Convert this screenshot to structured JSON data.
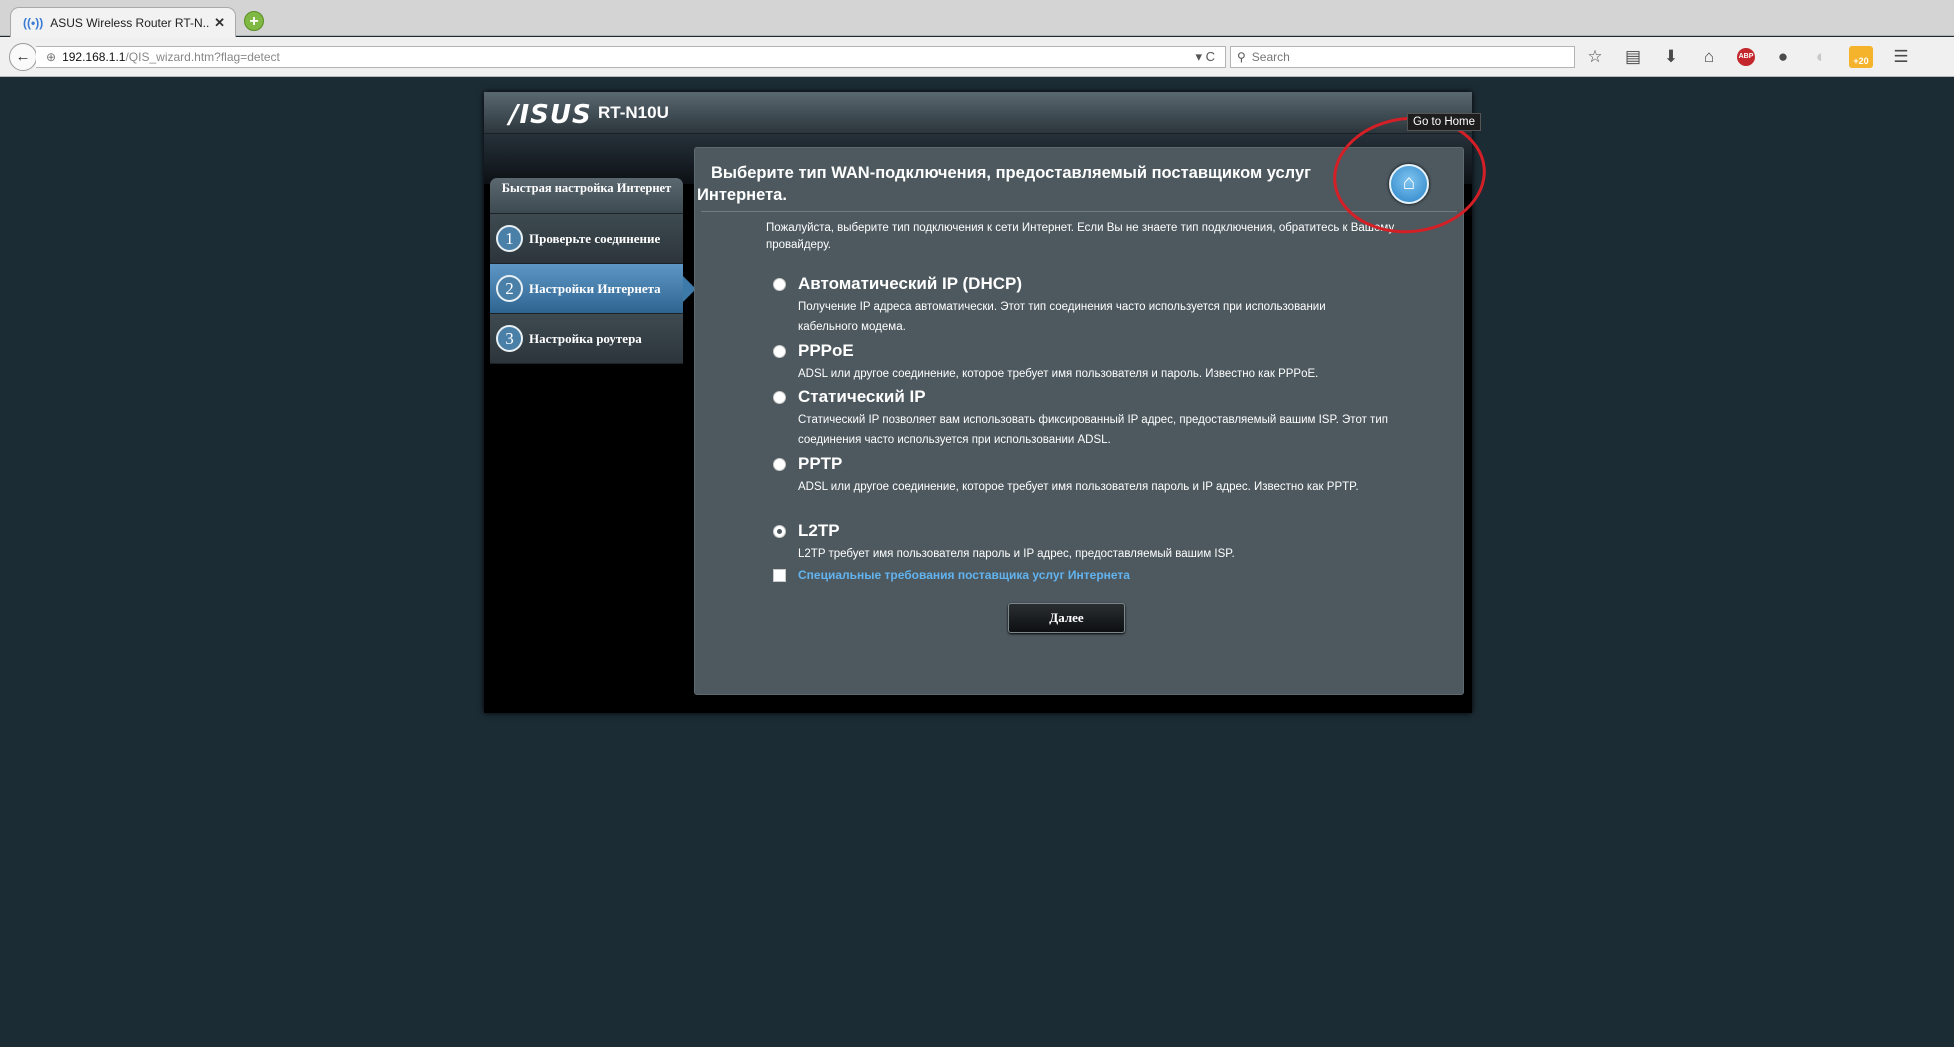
{
  "browser": {
    "tab_title": "ASUS Wireless Router RT-N...",
    "url_host": "192.168.1.1",
    "url_path": "/QIS_wizard.htm?flag=detect",
    "search_placeholder": "Search"
  },
  "router": {
    "brand": "/ISUS",
    "model": "RT-N10U"
  },
  "sidebar": {
    "title": "Быстрая настройка Интернет",
    "steps": [
      {
        "num": "1",
        "label": "Проверьте соединение"
      },
      {
        "num": "2",
        "label": "Настройки Интернета"
      },
      {
        "num": "3",
        "label": "Настройка роутера"
      }
    ]
  },
  "main": {
    "title": "Выберите тип WAN-подключения, предоставляемый поставщиком услуг Интернета.",
    "intro": "Пожалуйста, выберите тип подключения к сети Интернет. Если Вы не знаете тип подключения, обратитесь к Вашему провайдеру.",
    "options": [
      {
        "title": "Автоматический IP (DHCP)",
        "desc": "Получение IP адреса автоматически. Этот тип соединения часто используется при использовании кабельного модема."
      },
      {
        "title": "PPPoE",
        "desc": "ADSL или другое соединение, которое требует имя пользователя и пароль. Известно как PPPoE."
      },
      {
        "title": "Статический IP",
        "desc": "Статический IP позволяет вам использовать фиксированный IP адрес, предоставляемый вашим ISP. Этот тип соединения часто используется при использовании ADSL."
      },
      {
        "title": "PPTP",
        "desc": "ADSL или другое соединение, которое требует имя пользователя пароль и IP адрес. Известно как PPTP."
      },
      {
        "title": "L2TP",
        "desc": "L2TP требует имя пользователя пароль и IP адрес, предоставляемый вашим ISP."
      }
    ],
    "selected_option": "L2TP",
    "special_requirements_link": "Специальные требования поставщика услуг Интернета",
    "special_requirements_checked": false,
    "next_button": "Далее",
    "home_tooltip": "Go to Home"
  },
  "colors": {
    "page_bg": "#1c2c35",
    "panel_bg": "#4d595f",
    "active_step": "#3d7aa9",
    "link": "#62b3ef",
    "annotation": "#d41f26"
  },
  "icons": [
    "back-arrow-icon",
    "globe-icon",
    "reload-icon",
    "search-icon",
    "bookmark-star-icon",
    "reading-list-icon",
    "download-icon",
    "home-icon",
    "adblock-icon",
    "chat-icon",
    "lightbulb-icon",
    "notification-badge-icon",
    "menu-icon",
    "router-home-icon"
  ]
}
